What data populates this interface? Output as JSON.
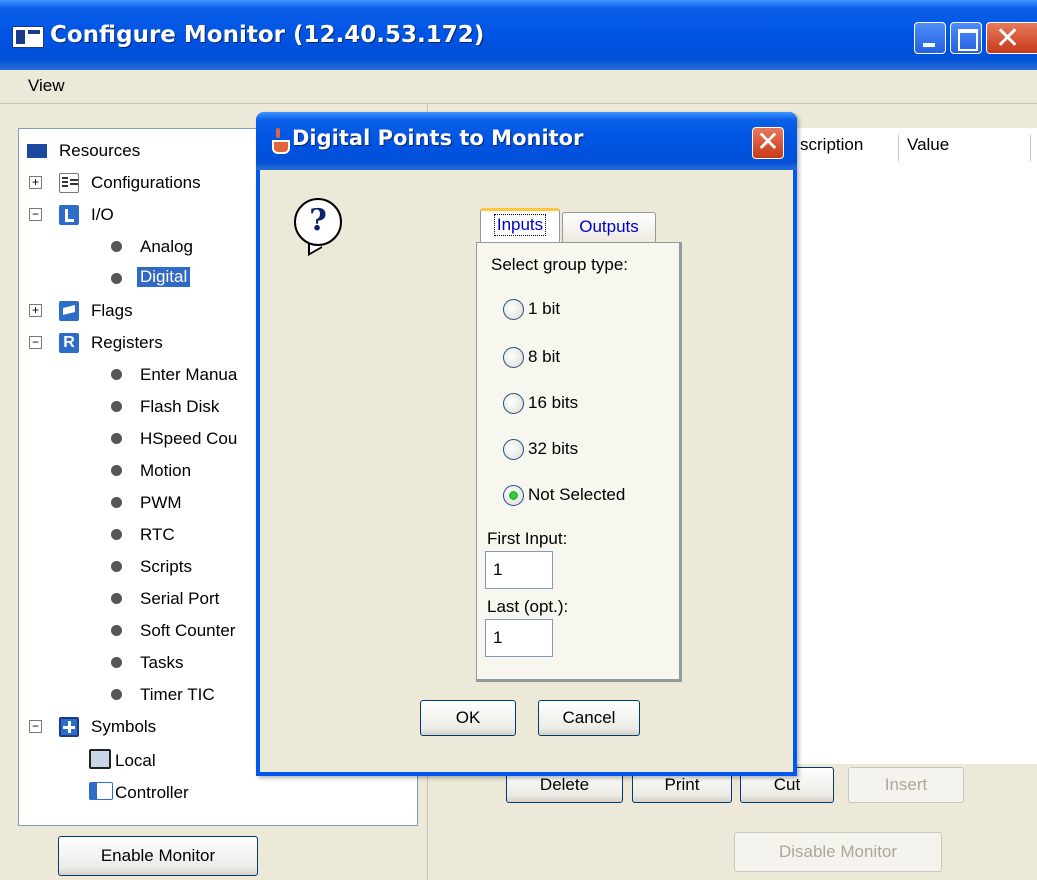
{
  "window": {
    "title": "Configure Monitor (12.40.53.172)"
  },
  "menu": {
    "view": "View"
  },
  "tree": {
    "root": "Resources",
    "configurations": "Configurations",
    "io": "I/O",
    "io_children": [
      "Analog",
      "Digital"
    ],
    "flags": "Flags",
    "registers": "Registers",
    "register_children": [
      "Enter Manua",
      "Flash Disk",
      "HSpeed Cou",
      "Motion",
      "PWM",
      "RTC",
      "Scripts",
      "Serial Port",
      "Soft Counter",
      "Tasks",
      "Timer TIC"
    ],
    "symbols": "Symbols",
    "symbol_children": [
      "Local",
      "Controller"
    ],
    "selected": "Digital"
  },
  "left_buttons": {
    "enable_monitor": "Enable Monitor"
  },
  "table": {
    "columns": [
      "scription",
      "Value"
    ]
  },
  "right_buttons": {
    "delete": "Delete",
    "print": "Print",
    "cut": "Cut",
    "insert": "Insert",
    "disable_monitor": "Disable Monitor"
  },
  "dialog": {
    "title": "Digital Points to Monitor",
    "tabs": [
      "Inputs",
      "Outputs"
    ],
    "active_tab": "Inputs",
    "group_label": "Select group type:",
    "radio_options": [
      "1 bit",
      "8 bit",
      "16 bits",
      "32 bits",
      "Not Selected"
    ],
    "selected_option": "Not Selected",
    "first_label": "First Input:",
    "first_value": "1",
    "last_label": "Last (opt.):",
    "last_value": "1",
    "ok": "OK",
    "cancel": "Cancel"
  }
}
